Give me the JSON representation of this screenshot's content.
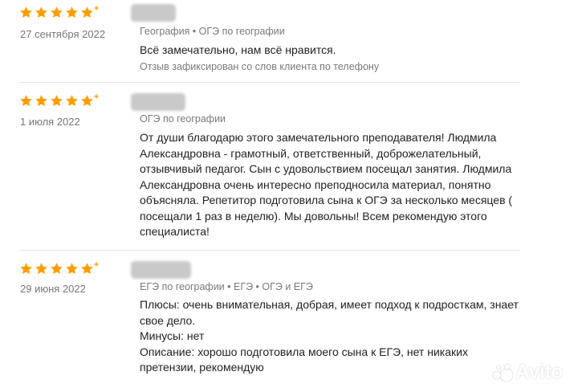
{
  "colors": {
    "star": "#ff9d00",
    "divider": "#e6e6e6",
    "meta": "#7a7a7a"
  },
  "reviews": [
    {
      "rating": 5,
      "date": "27 сентября 2022",
      "subjects": "География • ОГЭ по географии",
      "text_lines": [
        "Всё замечательно, нам всё нравится."
      ],
      "note": "Отзыв зафиксирован со слов клиента по телефону"
    },
    {
      "rating": 5,
      "date": "1 июля 2022",
      "subjects": "ОГЭ по географии",
      "text_lines": [
        "От души благодарю этого замечательного преподавателя! Людмила",
        "Александровна - грамотный, ответственный, доброжелательный,",
        "отзывчивый педагог. Сын с удовольствием посещал занятия. Людмила",
        "Александровна очень интересно преподносила материал, понятно",
        "объясняла. Репетитор подготовила сына к ОГЭ за несколько месяцев (",
        "посещали 1 раз в неделю). Мы довольны! Всем рекомендую этого",
        "специалиста!"
      ]
    },
    {
      "rating": 5,
      "date": "29 июня 2022",
      "subjects": "ЕГЭ по географии • ЕГЭ • ОГЭ и ЕГЭ",
      "text_lines": [
        "Плюсы: очень внимательная, добрая, имеет подход к подросткам, знает",
        "свое дело.",
        "Минусы: нет",
        "Описание: хорошо подготовила моего сына к ЕГЭ, нет никаких",
        "претензии, рекомендую"
      ]
    }
  ],
  "watermark": {
    "text": "Avito",
    "icon": "avito-logo-icon"
  }
}
